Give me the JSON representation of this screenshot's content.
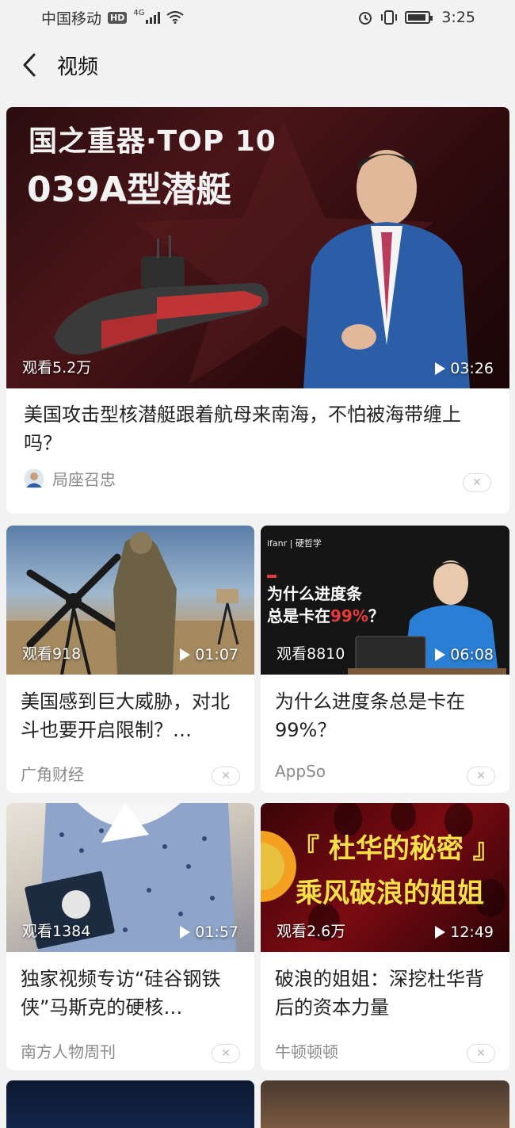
{
  "status": {
    "carrier": "中国移动",
    "hd": "HD",
    "net": "4G",
    "time": "3:25"
  },
  "nav": {
    "title": "视频"
  },
  "featured": {
    "overlay_line1": "国之重器·TOP 10",
    "overlay_line2": "039A型潜艇",
    "views": "观看5.2万",
    "duration": "03:26",
    "title": "美国攻击型核潜艇跟着航母来南海，不怕被海带缠上吗？",
    "source": "局座召忠"
  },
  "grid": [
    {
      "views": "观看918",
      "duration": "01:07",
      "title": "美国感到巨大威胁，对北斗也要开启限制？…",
      "source": "广角财经"
    },
    {
      "views": "观看8810",
      "duration": "06:08",
      "title": "为什么进度条总是卡在99%？",
      "source": "AppSo",
      "thumb_brand": "ifanr | 硬哲学",
      "thumb_q1": "为什么进度条",
      "thumb_q2a": "总是卡在",
      "thumb_q2b": "99%",
      "thumb_q2c": "？"
    },
    {
      "views": "观看1384",
      "duration": "01:57",
      "title": "独家视频专访“硅谷钢铁侠”马斯克的硬核…",
      "source": "南方人物周刊"
    },
    {
      "views": "观看2.6万",
      "duration": "12:49",
      "title": "破浪的姐姐：深挖杜华背后的资本力量",
      "source": "牛顿顿顿",
      "thumb_s1": "『 杜华的秘密 』",
      "thumb_s2": "乘风破浪的姐姐"
    }
  ],
  "colors": {
    "accent_red": "#e83a3a",
    "muted_text": "#8a8a8a"
  }
}
